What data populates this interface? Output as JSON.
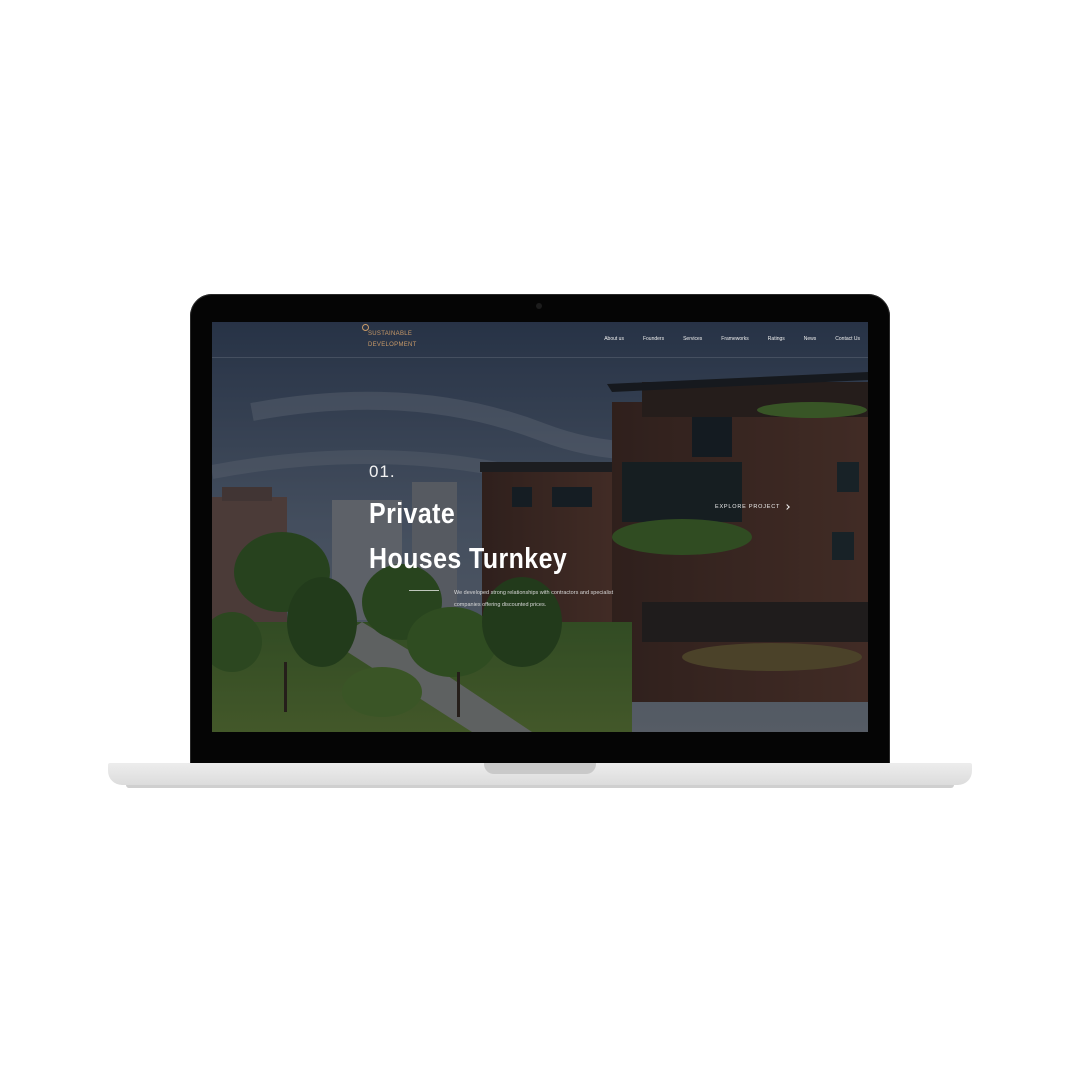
{
  "site": {
    "logo": {
      "line1": "SUSTAINABLE",
      "line2": "DEVELOPMENT"
    },
    "nav": [
      "About us",
      "Founders",
      "Services",
      "Frameworks",
      "Ratings",
      "News",
      "Contact Us"
    ]
  },
  "hero": {
    "number": "01.",
    "title_line1": "Private",
    "title_line2": "Houses Turnkey",
    "description": "We developed strong relationships with contractors and specialist companies offering discounted prices.",
    "cta": "EXPLORE PROJECT"
  },
  "colors": {
    "accent": "#c99a68",
    "overlay": "#0a0c12",
    "building": "#5a3a2c",
    "greenery": "#3f6b2a"
  }
}
